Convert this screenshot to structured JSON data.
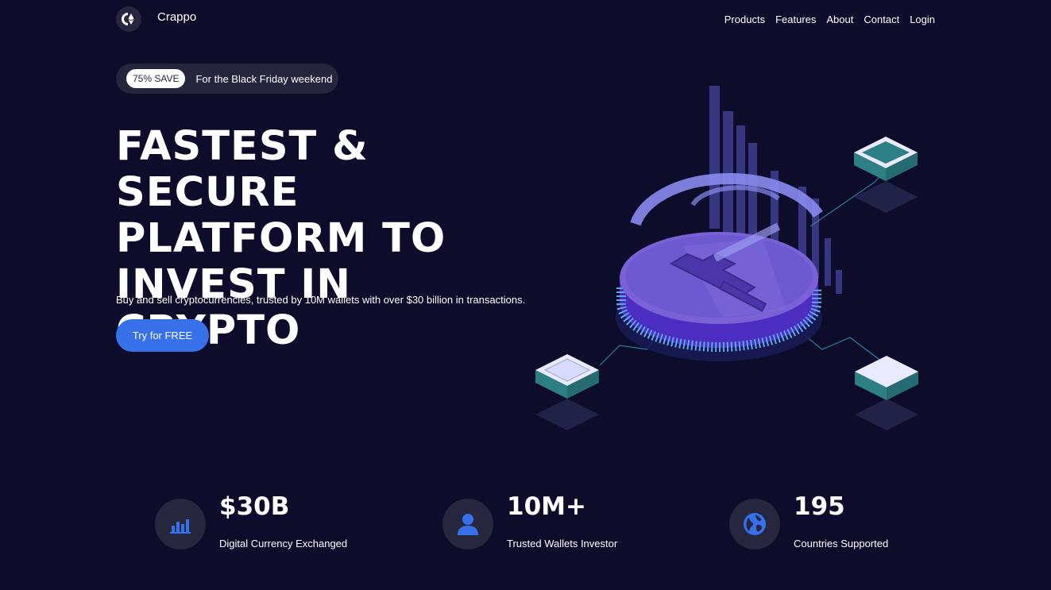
{
  "brand": {
    "name": "Crappo",
    "logo_icon": "ethereum-logo-icon"
  },
  "nav": {
    "items": [
      "Products",
      "Features",
      "About",
      "Contact",
      "Login"
    ]
  },
  "promo": {
    "badge": "75% SAVE",
    "text": "For the Black Friday weekend"
  },
  "hero": {
    "title_lines": [
      "FASTEST & SECURE",
      "PLATFORM TO",
      "INVEST IN CRYPTO"
    ],
    "subtitle": "Buy and sell cryptocurrencies, trusted by 10M wallets with over $30 billion in transactions.",
    "cta_label": "Try for FREE"
  },
  "stats": [
    {
      "value": "$30B",
      "label": "Digital Currency Exchanged",
      "icon": "bar-chart-icon"
    },
    {
      "value": "10M+",
      "label": "Trusted Wallets Investor",
      "icon": "user-icon"
    },
    {
      "value": "195",
      "label": "Countries Supported",
      "icon": "globe-icon"
    }
  ],
  "colors": {
    "background": "#0d0c2b",
    "accent": "#3671e9",
    "surface": "#26273e",
    "coin": "#6c58d8",
    "teal": "#2d7f86"
  }
}
